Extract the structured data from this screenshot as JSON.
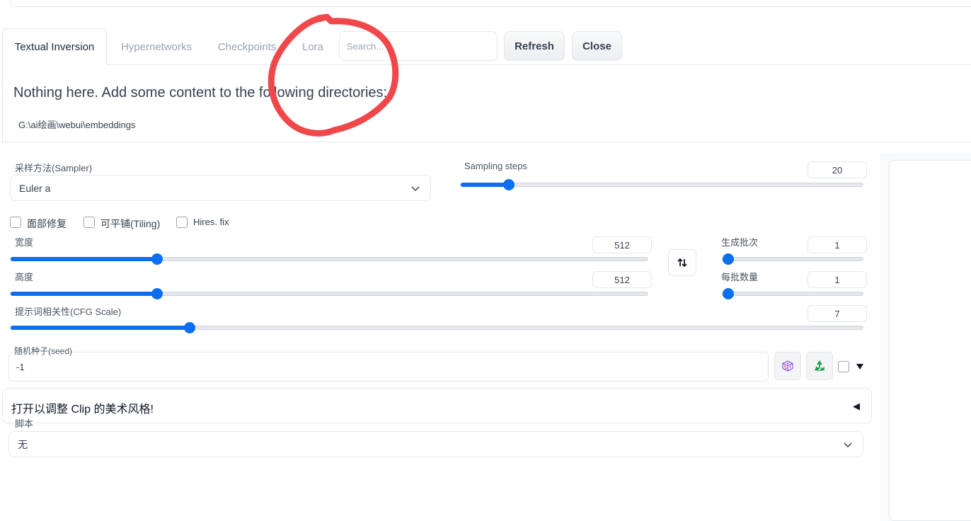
{
  "tabs": [
    {
      "label": "Textual Inversion",
      "active": true
    },
    {
      "label": "Hypernetworks",
      "active": false
    },
    {
      "label": "Checkpoints",
      "active": false
    },
    {
      "label": "Lora",
      "active": false
    }
  ],
  "search": {
    "placeholder": "Search...",
    "value": ""
  },
  "buttons": {
    "refresh": "Refresh",
    "close": "Close"
  },
  "extra_networks": {
    "empty_message": "Nothing here. Add some content to the following directories:",
    "directory": "G:\\ai绘画\\webui\\embeddings"
  },
  "sampler": {
    "label": "采样方法(Sampler)",
    "value": "Euler a"
  },
  "sampling_steps": {
    "label": "Sampling steps",
    "value": "20",
    "fraction": 0.12
  },
  "checkboxes": [
    {
      "label": "面部修复",
      "checked": false
    },
    {
      "label": "可平铺(Tiling)",
      "checked": false
    },
    {
      "label": "Hires. fix",
      "checked": false
    }
  ],
  "width": {
    "label": "宽度",
    "value": "512",
    "fraction": 0.23
  },
  "height": {
    "label": "高度",
    "value": "512",
    "fraction": 0.23
  },
  "batch_count": {
    "label": "生成批次",
    "value": "1",
    "fraction": 0.0
  },
  "batch_size": {
    "label": "每批数量",
    "value": "1",
    "fraction": 0.0
  },
  "cfg_scale": {
    "label": "提示词相关性(CFG Scale)",
    "value": "7",
    "fraction": 0.21
  },
  "seed": {
    "label": "随机种子(seed)",
    "value": "-1"
  },
  "icons": {
    "swap": "swap-dimensions-icon",
    "dice": "dice-icon",
    "recycle": "recycle-icon",
    "seed_extra_toggle": "triangle-down-icon",
    "accordion_arrow": "triangle-left-icon"
  },
  "clip_accordion": {
    "label": "打开以调整 Clip 的美术风格!",
    "arrow": "◀"
  },
  "script": {
    "label": "脚本",
    "value": "无"
  },
  "colors": {
    "accent": "#0b6ff0",
    "annotation": "#f0484a"
  }
}
